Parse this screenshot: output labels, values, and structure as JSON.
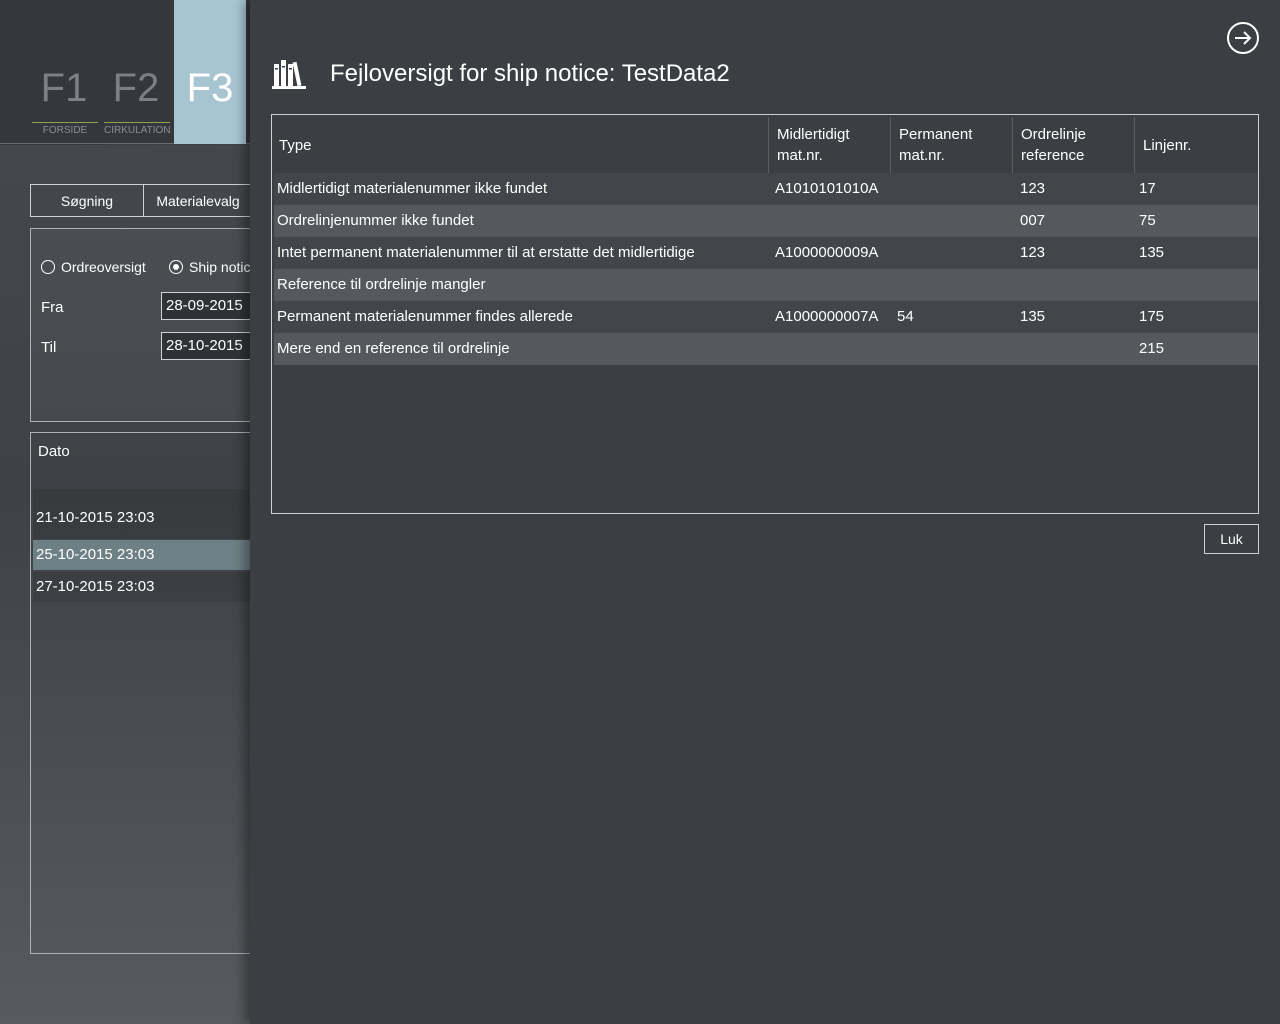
{
  "nav": {
    "keys": [
      {
        "key": "F1",
        "label": "FORSIDE"
      },
      {
        "key": "F2",
        "label": "CIRKULATION"
      },
      {
        "key": "F3",
        "label": ""
      }
    ]
  },
  "background": {
    "tabs": [
      "Søgning",
      "Materialevalg"
    ],
    "filter": {
      "radio_ordre": "Ordreoversigt",
      "radio_ship": "Ship notice",
      "fra_label": "Fra",
      "fra_value": "28-09-2015",
      "til_label": "Til",
      "til_value": "28-10-2015"
    },
    "list": {
      "header": "Dato",
      "rows": [
        "21-10-2015 23:03",
        "25-10-2015 23:03",
        "27-10-2015 23:03"
      ]
    }
  },
  "panel": {
    "title": "Fejloversigt for ship notice: TestData2",
    "close_label": "Luk",
    "table": {
      "headers": {
        "type": "Type",
        "midl_1": "Midlertidigt",
        "midl_2": "mat.nr.",
        "perm_1": "Permanent",
        "perm_2": "mat.nr.",
        "ordre_1": "Ordrelinje",
        "ordre_2": "reference",
        "linje": "Linjenr."
      },
      "rows": [
        {
          "type": "Midlertidigt materialenummer ikke fundet",
          "midl": "A1010101010A",
          "perm": "",
          "ordre": "123",
          "linje": "17"
        },
        {
          "type": "Ordrelinjenummer ikke fundet",
          "midl": "",
          "perm": "",
          "ordre": "007",
          "linje": "75"
        },
        {
          "type": "Intet permanent materialenummer til at erstatte det midlertidige",
          "midl": "A1000000009A",
          "perm": "",
          "ordre": "123",
          "linje": "135"
        },
        {
          "type": "Reference til ordrelinje mangler",
          "midl": "",
          "perm": "",
          "ordre": "",
          "linje": ""
        },
        {
          "type": "Permanent materialenummer findes allerede",
          "midl": "A1000000007A",
          "perm": "54",
          "ordre": "135",
          "linje": "175"
        },
        {
          "type": "Mere end en reference til ordrelinje",
          "midl": "",
          "perm": "",
          "ordre": "",
          "linje": "215"
        }
      ]
    }
  }
}
